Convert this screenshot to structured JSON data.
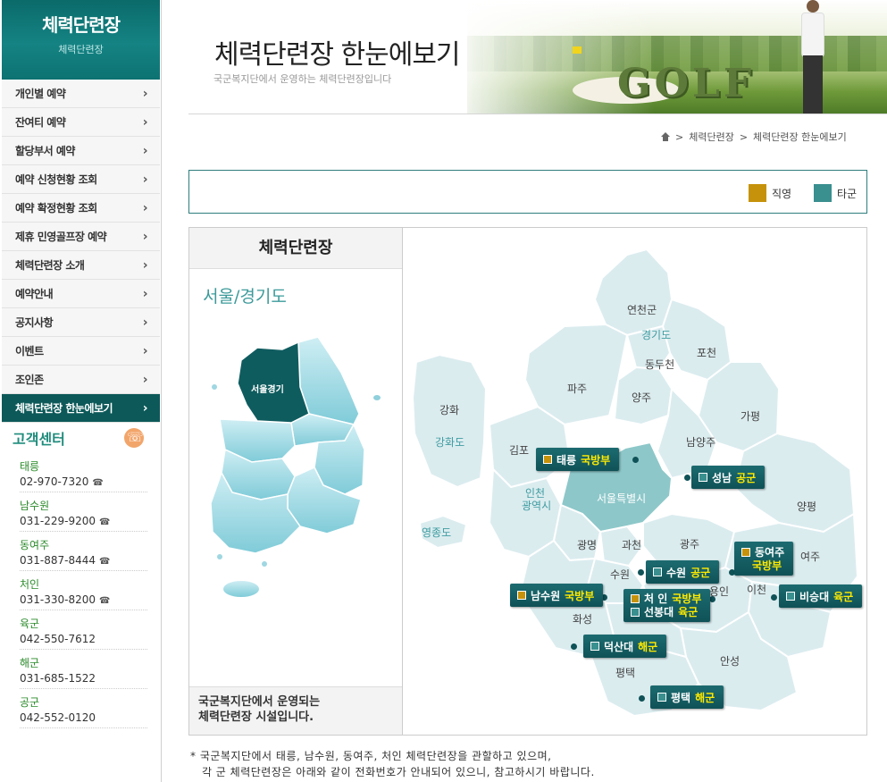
{
  "sidebar": {
    "title": "체력단련장",
    "subtitle": "체력단련장",
    "menu": [
      {
        "label": "개인별 예약"
      },
      {
        "label": "잔여티 예약"
      },
      {
        "label": "할당부서 예약"
      },
      {
        "label": "예약 신청현황 조회"
      },
      {
        "label": "예약 확정현황 조회"
      },
      {
        "label": "제휴 민영골프장 예약"
      },
      {
        "label": "체력단련장 소개"
      },
      {
        "label": "예약안내"
      },
      {
        "label": "공지사항"
      },
      {
        "label": "이벤트"
      },
      {
        "label": "조인존"
      },
      {
        "label": "체력단련장 한눈에보기",
        "active": true
      }
    ],
    "chevron": "›",
    "customer_center": {
      "title": "고객센터",
      "icon": "phone-icon",
      "contacts": [
        {
          "name": "태릉",
          "phone": "02-970-7320",
          "tel": "☎"
        },
        {
          "name": "남수원",
          "phone": "031-229-9200",
          "tel": "☎"
        },
        {
          "name": "동여주",
          "phone": "031-887-8444",
          "tel": "☎"
        },
        {
          "name": "처인",
          "phone": "031-330-8200",
          "tel": "☎"
        },
        {
          "name": "육군",
          "phone": "042-550-7612",
          "tel": ""
        },
        {
          "name": "해군",
          "phone": "031-685-1522",
          "tel": ""
        },
        {
          "name": "공군",
          "phone": "042-552-0120",
          "tel": ""
        }
      ]
    }
  },
  "banner": {
    "title": "체력단련장 한눈에보기",
    "subtitle": "국군복지단에서 운영하는 체력단련장입니다",
    "logo_text": "GOLF"
  },
  "breadcrumb": {
    "items": [
      "체력단련장",
      "체력단련장 한눈에보기"
    ],
    "separator": ">"
  },
  "legend": {
    "own": {
      "label": "직영",
      "color": "#c6920b"
    },
    "other": {
      "label": "타군",
      "color": "#3a8f8f"
    }
  },
  "panel": {
    "title": "체력단련장",
    "region": "서울/경기도",
    "korea_label": "서울경기",
    "footer_line1": "국군복지단에서 운영되는",
    "footer_line2": "체력단련장 시설입니다."
  },
  "map": {
    "places": {
      "yeoncheon": "연천군",
      "gyeonggi": "경기도",
      "pocheon": "포천",
      "dongducheon": "동두천",
      "paju": "파주",
      "yangju": "양주",
      "gapyeong": "가평",
      "ganghwa": "강화",
      "ganghwa_isl": "강화도",
      "gimpo": "김포",
      "namyangju": "남양주",
      "incheon1": "인천",
      "incheon2": "광역시",
      "seoul": "서울특별시",
      "yangpyeong": "양평",
      "yeongjong": "영종도",
      "gwangmyeong": "광명",
      "gwacheon": "과천",
      "gwangju": "광주",
      "yeoju": "여주",
      "suwon": "수원",
      "yongin": "용인",
      "icheon": "이천",
      "hwaseong": "화성",
      "anseong": "안성",
      "pyeongtaek": "평택"
    },
    "markers": {
      "taereung": {
        "name": "태릉",
        "unit": "국방부"
      },
      "seongnam": {
        "name": "성남",
        "unit": "공군"
      },
      "dongyeoju": {
        "name": "동여주",
        "unit": "국방부"
      },
      "suwon": {
        "name": "수원",
        "unit": "공군"
      },
      "namsuwon": {
        "name": "남수원",
        "unit": "국방부"
      },
      "cheoin": {
        "name": "처   인",
        "unit": "국방부"
      },
      "seonbongdae": {
        "name": "선봉대",
        "unit": "육군"
      },
      "biseungdae": {
        "name": "비승대",
        "unit": "육군"
      },
      "deoksandae": {
        "name": "덕산대",
        "unit": "해군"
      },
      "pyeongtaek": {
        "name": "평택",
        "unit": "해군"
      }
    }
  },
  "notes": {
    "line1": "* 국군복지단에서 태릉, 남수원, 동여주, 처인 체력단련장을 관할하고 있으며,",
    "line2": "   각 군 체력단련장은 아래와 같이 전화번호가 안내되어 있으니, 참고하시기 바랍니다."
  }
}
